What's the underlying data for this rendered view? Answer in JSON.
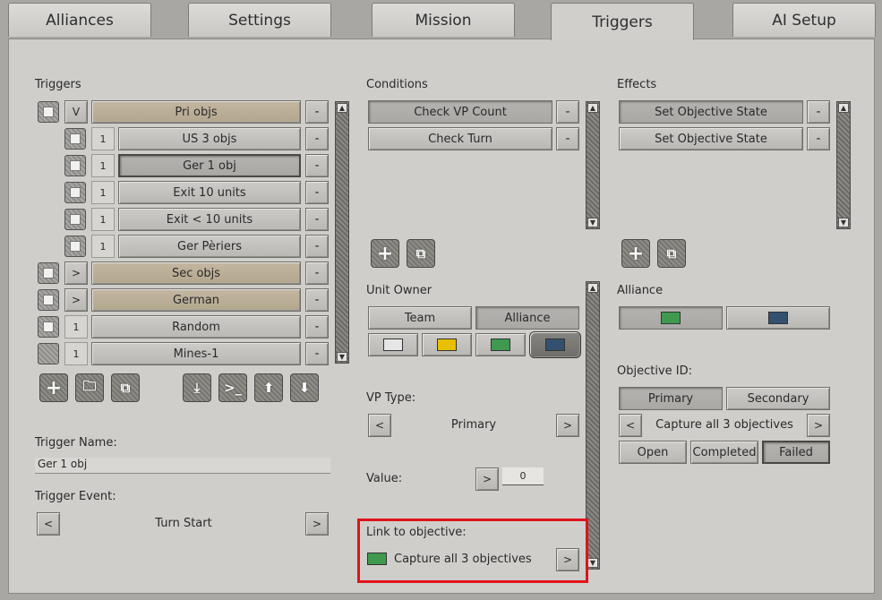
{
  "tabs": [
    "Alliances",
    "Settings",
    "Mission",
    "Triggers",
    "AI Setup"
  ],
  "triggers": {
    "header": "Triggers",
    "items": [
      {
        "toggle": "V",
        "label": "Pri objs",
        "minus": "-"
      },
      {
        "toggle": "1",
        "label": "US 3 objs",
        "minus": "-"
      },
      {
        "toggle": "1",
        "label": "Ger 1 obj",
        "minus": "-"
      },
      {
        "toggle": "1",
        "label": "Exit 10 units",
        "minus": "-"
      },
      {
        "toggle": "1",
        "label": "Exit < 10 units",
        "minus": "-"
      },
      {
        "toggle": "1",
        "label": "Ger Pèriers",
        "minus": "-"
      },
      {
        "toggle": ">",
        "label": "Sec objs",
        "minus": "-"
      },
      {
        "toggle": ">",
        "label": "German",
        "minus": "-"
      },
      {
        "toggle": "1",
        "label": "Random",
        "minus": "-"
      },
      {
        "toggle": "1",
        "label": "Mines-1",
        "minus": "-"
      }
    ],
    "name_label": "Trigger Name:",
    "name_value": "Ger 1 obj",
    "event_label": "Trigger Event:",
    "event_value": "Turn Start",
    "prev": "<",
    "next": ">"
  },
  "conditions": {
    "header": "Conditions",
    "items": [
      {
        "label": "Check VP Count",
        "minus": "-"
      },
      {
        "label": "Check Turn",
        "minus": "-"
      }
    ],
    "unit_owner_label": "Unit Owner",
    "team_btn": "Team",
    "alliance_btn": "Alliance",
    "vp_type_label": "VP Type:",
    "vp_type_value": "Primary",
    "value_label": "Value:",
    "value_value": "0",
    "link_label": "Link to objective:",
    "link_value": "Capture all 3 objectives",
    "prev": "<",
    "next": ">"
  },
  "effects": {
    "header": "Effects",
    "items": [
      {
        "label": "Set Objective State",
        "minus": "-"
      },
      {
        "label": "Set Objective State",
        "minus": "-"
      }
    ],
    "alliance_label": "Alliance",
    "objective_id_label": "Objective ID:",
    "primary_btn": "Primary",
    "secondary_btn": "Secondary",
    "objective_value": "Capture all 3 objectives",
    "open_btn": "Open",
    "completed_btn": "Completed",
    "failed_btn": "Failed",
    "prev": "<",
    "next": ">"
  },
  "icons": {
    "plus": "+",
    "scroll_up": "▲",
    "scroll_down": "▼"
  },
  "colors": {
    "swatch_white": "#e6e6e6",
    "swatch_yellow": "#e8c000",
    "swatch_green": "#3f9a4f",
    "swatch_blue": "#34506f",
    "highlight": "#e0131b"
  }
}
